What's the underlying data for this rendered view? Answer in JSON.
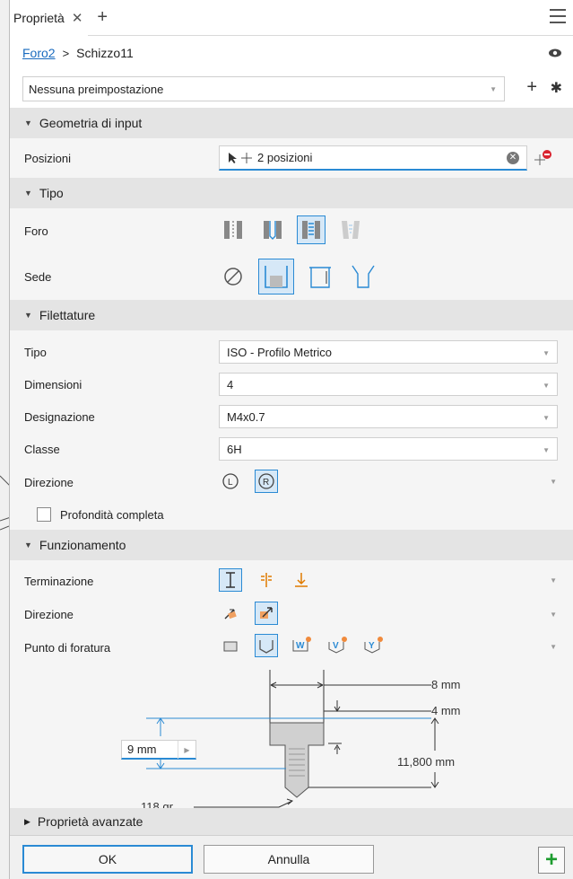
{
  "tab": {
    "title": "Proprietà",
    "close": "✕",
    "add": "+"
  },
  "breadcrumb": {
    "feature": "Foro2",
    "separator": ">",
    "sketch": "Schizzo11"
  },
  "preset": {
    "value": "Nessuna preimpostazione"
  },
  "sections": {
    "input": "Geometria di input",
    "tipo": "Tipo",
    "thread": "Filettature",
    "behavior": "Funzionamento",
    "advanced": "Proprietà avanzate"
  },
  "input": {
    "positions_label": "Posizioni",
    "positions_value": "2 posizioni"
  },
  "tipo": {
    "hole_label": "Foro",
    "seat_label": "Sede"
  },
  "thread": {
    "type_label": "Tipo",
    "type_value": "ISO - Profilo  Metrico",
    "size_label": "Dimensioni",
    "size_value": "4",
    "designation_label": "Designazione",
    "designation_value": "M4x0.7",
    "class_label": "Classe",
    "class_value": "6H",
    "direction_label": "Direzione",
    "full_depth_label": "Profondità completa"
  },
  "behavior": {
    "termination_label": "Terminazione",
    "direction_label": "Direzione",
    "drill_point_label": "Punto di foratura",
    "drill_letters": [
      "W",
      "V",
      "Y"
    ]
  },
  "diagram": {
    "diameter": "8 mm",
    "head_depth": "4 mm",
    "depth_input": "9 mm",
    "total_depth": "11,800 mm",
    "angle": "118 gr"
  },
  "footer": {
    "ok": "OK",
    "cancel": "Annulla",
    "plus": "+"
  },
  "colors": {
    "accent": "#2a8ad4",
    "selected_bg": "#d6e8f7",
    "section_bg": "#e4e4e4",
    "badge": "#f08a3c",
    "green": "#1d9c2f"
  }
}
